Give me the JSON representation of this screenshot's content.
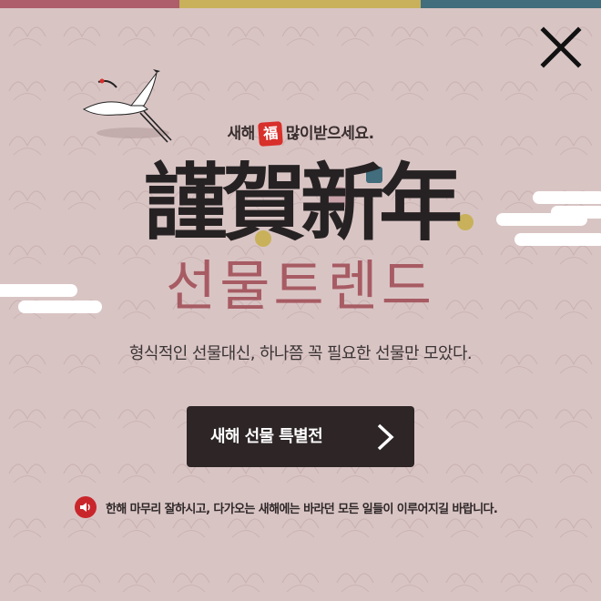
{
  "popup": {
    "colors": {
      "background": "#d9c4c4",
      "topbar": [
        "#ad5e6a",
        "#c8b15a",
        "#416d7d"
      ],
      "title": "#262223",
      "subtitle": "#a75b63",
      "button_bg": "#2d2526",
      "accent_red": "#c9262b"
    },
    "close_icon": "close-icon",
    "greeting": {
      "before": "새해",
      "seal": "福",
      "after": "많이받으세요."
    },
    "title_hanja": "謹賀新年",
    "subtitle": "선물트렌드",
    "description": "형식적인 선물대신, 하나쯤 꼭 필요한 선물만 모았다.",
    "cta": {
      "label": "새해 선물 특별전",
      "icon": "chevron-right-icon"
    },
    "notice": {
      "icon": "speaker-icon",
      "text": "한해 마무리 잘하시고, 다가오는 새해에는 바라던 모든 일들이 이루어지길 바랍니다."
    }
  }
}
